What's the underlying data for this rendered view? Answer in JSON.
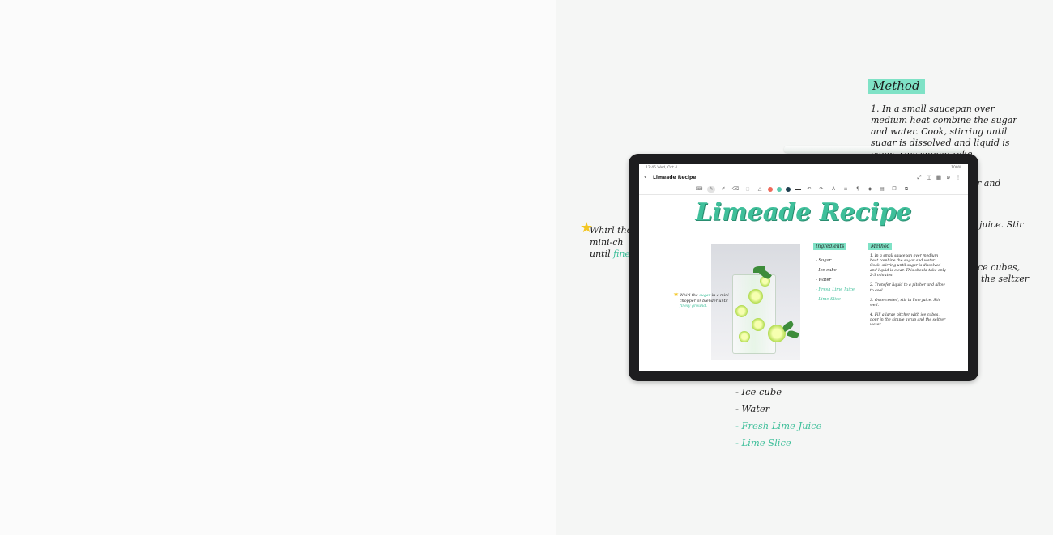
{
  "note": {
    "title": "Limeade Recipe",
    "heading": "Limeade Recipe"
  },
  "status_bar": {
    "time": "12:45 Wed, Oct 4",
    "right": "100%"
  },
  "icons": {
    "back": "chevron-left-icon",
    "appbar": [
      "expand-icon",
      "reader-icon",
      "grid-icon",
      "attach-icon",
      "more-icon"
    ],
    "tools": [
      "keyboard-icon",
      "pen-icon",
      "highlighter-icon",
      "eraser-icon",
      "lasso-icon",
      "shape-icon"
    ],
    "tools2": [
      "undo-icon",
      "redo-icon",
      "text-icon",
      "align-icon",
      "format-icon",
      "fill-icon",
      "grid-icon",
      "layers-icon",
      "copy-icon"
    ]
  },
  "pen_colors": [
    "#ef6a5b",
    "#59c9ae",
    "#1e3f4f"
  ],
  "photo_note": {
    "before": "Whirl the ",
    "highlight1": "sugar",
    "mid": " in a mini-chopper or blender until ",
    "highlight2": "finely ground."
  },
  "ingredients": {
    "heading": "Ingredients",
    "items": [
      {
        "text": "- Sugar",
        "accent": false
      },
      {
        "text": "- Ice cube",
        "accent": false
      },
      {
        "text": "- Water",
        "accent": false
      },
      {
        "text": "- Fresh Lime Juice",
        "accent": true
      },
      {
        "text": "- Lime Slice",
        "accent": true
      }
    ]
  },
  "method": {
    "heading": "Method",
    "steps": [
      "1. In a small saucepan over medium heat combine the sugar and water. Cook, stirring until sugar is dissolved and liquid is clear. This should take only 2-3 minutes.",
      "2. Transfer liquid to a pitcher and allow to cool.",
      "3. Once cooled, stir in lime juice. Stir well.",
      "4. Fill a large pitcher with ice cubes, pour in the simple syrup and the seltzer water."
    ]
  },
  "background": {
    "method_heading": "Method",
    "method_text": "1. In a small saucepan over medium heat combine the sugar and water. Cook, stirring until sugar is dissolved and liquid is clear. This should take",
    "fragments": [
      "r and",
      "juice. Stir",
      "ce cubes,",
      "the seltzer"
    ],
    "note_line1": "Whirl the",
    "note_line2": "mini-ch",
    "note_line3_a": "until ",
    "note_line3_b": "fine",
    "ingredients": [
      {
        "text": "- Ice cube",
        "accent": false
      },
      {
        "text": "- Water",
        "accent": false
      },
      {
        "text": "- Fresh Lime Juice",
        "accent": true
      },
      {
        "text": "- Lime Slice",
        "accent": true
      }
    ]
  }
}
